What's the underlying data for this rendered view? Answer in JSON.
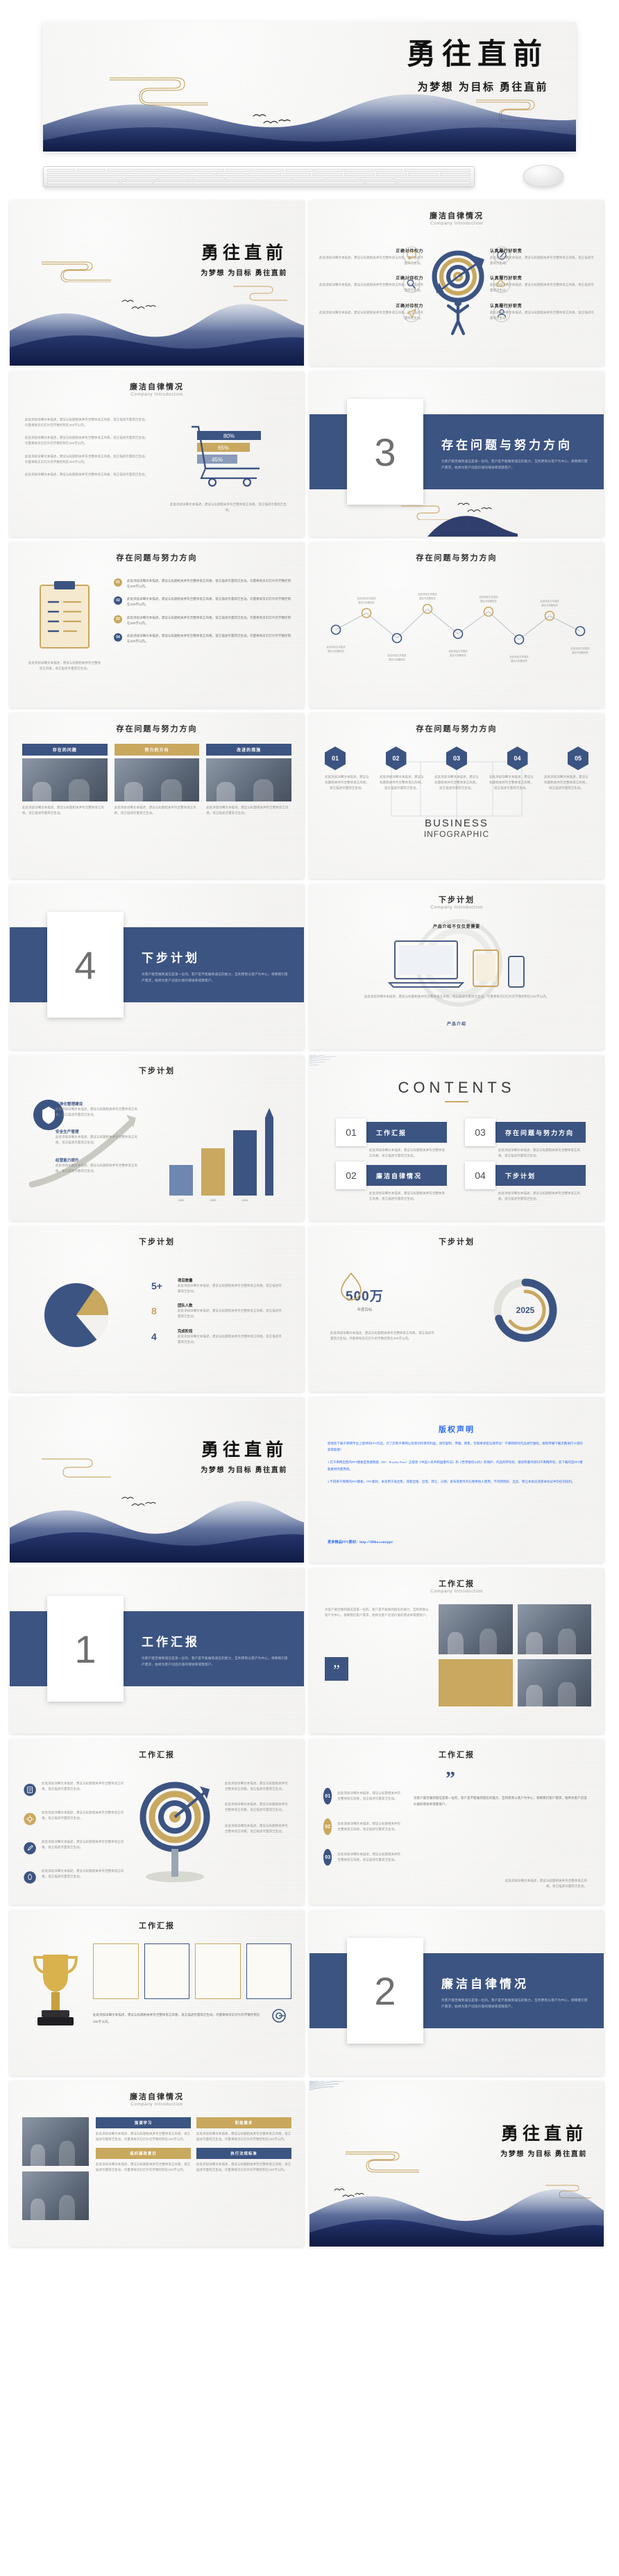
{
  "hero": {
    "title": "勇往直前",
    "subtitle": "为梦想 为目标 勇往直前"
  },
  "devices": {
    "keyboard_label": "keyboard-mockup",
    "mouse_label": "mouse-mockup"
  },
  "filler": {
    "short": "此处添加详细文本描述，建议与标题相关并符合整体语言风格，语言描述尽量简洁生动。",
    "medium": "此处添加详细文本描述，建议与标题相关并符合整体语言风格，语言描述尽量简洁生动。尽量将每页幻灯片的字数控制在200字以内。",
    "long": "为客户能否做到诚信是第一位的。客户是不能做到诚信的能力，互利原则以客户为中心，保障我们客户需求，始终为客户创造价值的增进率或我客户。"
  },
  "slides": [
    {
      "id": "cover-1",
      "type": "cover",
      "title": "勇往直前",
      "subtitle": "为梦想 为目标 勇往直前"
    },
    {
      "id": "intro-target",
      "type": "content-target",
      "title": "廉洁自律情况",
      "subtitle": "Company Introduction",
      "left_items": [
        {
          "heading": "正确对待权力",
          "icon": "message-icon"
        },
        {
          "heading": "正确对待权力",
          "icon": "search-icon"
        },
        {
          "heading": "正确对待权力",
          "icon": "paper-plane-icon"
        }
      ],
      "right_items": [
        {
          "heading": "认真履行好职责",
          "icon": "compass-icon"
        },
        {
          "heading": "认真履行好职责",
          "icon": "cloud-icon"
        },
        {
          "heading": "认真履行好职责",
          "icon": "user-icon"
        }
      ]
    },
    {
      "id": "discipline-cart",
      "type": "content-cart",
      "title": "廉洁自律情况",
      "subtitle": "Company Introduction",
      "bars": [
        {
          "label": "80%",
          "color": "#3c5482"
        },
        {
          "label": "65%",
          "color": "#c9a85f"
        },
        {
          "label": "45%",
          "color": "#8b9bb8"
        }
      ]
    },
    {
      "id": "divider-3",
      "type": "divider",
      "number": "3",
      "title": "存在问题与努力方向"
    },
    {
      "id": "problems-list",
      "type": "content-list",
      "title": "存在问题与努力方向",
      "bullets": [
        {
          "marker": "01"
        },
        {
          "marker": "02"
        },
        {
          "marker": "03"
        },
        {
          "marker": "04"
        }
      ],
      "note": "存在问题与努力方向"
    },
    {
      "id": "problems-timeline",
      "type": "content-timeline",
      "title": "存在问题与努力方向",
      "points": 9
    },
    {
      "id": "problems-photos",
      "type": "content-photos",
      "title": "存在问题与努力方向",
      "cards": [
        {
          "label": "存在的问题",
          "accent": "#3c5482"
        },
        {
          "label": "努力的方向",
          "accent": "#c9a85f"
        },
        {
          "label": "改进的措施",
          "accent": "#3c5482"
        }
      ]
    },
    {
      "id": "problems-hex",
      "type": "content-hex",
      "title": "存在问题与努力方向",
      "hexes": [
        "01",
        "02",
        "03",
        "04",
        "05"
      ],
      "center_line1": "BUSINESS",
      "center_line2": "INFOGRAPHIC"
    },
    {
      "id": "divider-4",
      "type": "divider",
      "number": "4",
      "title": "下步计划"
    },
    {
      "id": "plan-devices",
      "type": "content-devices",
      "title": "下步计划",
      "subtitle": "Company Introduction",
      "heading": "产品介绍不仅仅是需要",
      "footer": "产品介绍"
    },
    {
      "id": "plan-chart",
      "type": "content-chart",
      "title": "下步计划",
      "bars": [
        {
          "label": "标准化管理建设"
        },
        {
          "label": "安全生产管理"
        },
        {
          "label": "经营能力提升"
        }
      ]
    },
    {
      "id": "contents",
      "type": "contents",
      "title": "CONTENTS",
      "items": [
        {
          "num": "01",
          "label": "工作汇报"
        },
        {
          "num": "02",
          "label": "廉洁自律情况"
        },
        {
          "num": "03",
          "label": "存在问题与努力方向"
        },
        {
          "num": "04",
          "label": "下步计划"
        }
      ]
    },
    {
      "id": "plan-pie",
      "type": "content-pie",
      "title": "下步计划",
      "stats": [
        {
          "value": "5+",
          "label": "项目数量"
        },
        {
          "value": "8",
          "label": "团队人数"
        },
        {
          "value": "4",
          "label": "完成阶段"
        }
      ]
    },
    {
      "id": "plan-donut",
      "type": "content-donut",
      "title": "下步计划",
      "big_value": "500万",
      "big_label": "年度目标",
      "ring_label": "2025"
    },
    {
      "id": "cover-2",
      "type": "cover",
      "title": "勇往直前",
      "subtitle": "为梦想 为目标 勇往直前"
    },
    {
      "id": "copyright",
      "type": "copyright",
      "title": "版权声明",
      "paragraphs": [
        "感谢您下载千库网平台上提供的PPT作品，为了您和千库网以及原创作者的利益，请勿复制、传播、销售，否则将承担法律责任！千库网将对作品进行维权，按照传播下载次数进行十倍的索取赔偿！",
        "1.在千库网出售的PPT模板是免版税类（RF：Royalty-Free）正版受《中国人民共和国著作法》和《世界版权公约》的保护，作品的所有权、版权和著作权归千库网所有，您下载的是PPT模板素材的使用权。",
        "2.不得将千库网的PPT模板、PPT素材，本身用于再出售，或者出租、出借、转让、分销、发布或者作为礼物供他人使用，不得转授权、出卖、转让本协议或者本协议中的任何权利。"
      ],
      "footer": "更多精品PPT素材：http://588ku.com/ppt/"
    },
    {
      "id": "divider-1",
      "type": "divider",
      "number": "1",
      "title": "工作汇报"
    },
    {
      "id": "work-photos",
      "type": "content-photos2",
      "title": "工作汇报",
      "subtitle": "Company Introduction"
    },
    {
      "id": "work-icons",
      "type": "content-icons",
      "title": "工作汇报",
      "icons": [
        {
          "name": "document-icon",
          "color": "#3c5482"
        },
        {
          "name": "gear-icon",
          "color": "#c9a85f"
        },
        {
          "name": "edit-icon",
          "color": "#3c5482"
        },
        {
          "name": "rocket-icon",
          "color": "#3c5482"
        }
      ]
    },
    {
      "id": "work-quote",
      "type": "content-quote",
      "title": "工作汇报",
      "quote_mark": "”",
      "steps": [
        "01",
        "02",
        "03"
      ]
    },
    {
      "id": "work-awards",
      "type": "content-awards",
      "title": "工作汇报",
      "certificates": 4
    },
    {
      "id": "divider-2",
      "type": "divider",
      "number": "2",
      "title": "廉洁自律情况"
    },
    {
      "id": "discipline-photos",
      "type": "content-grid4",
      "title": "廉洁自律情况",
      "subtitle": "Company Introduction",
      "cards": [
        {
          "label": "强调学习",
          "accent": "#3c5482"
        },
        {
          "label": "职能需求",
          "accent": "#c9a85f"
        },
        {
          "label": "组织廉政意识",
          "accent": "#c9a85f"
        },
        {
          "label": "执行法规标准",
          "accent": "#3c5482"
        }
      ]
    },
    {
      "id": "cover-3",
      "type": "cover-final",
      "title": "勇往直前",
      "subtitle": "为梦想 为目标 勇往直前"
    }
  ],
  "colors": {
    "navy": "#3c5482",
    "deep_navy": "#1b2a5e",
    "gold": "#c9a85f",
    "paper": "#f2f1ee",
    "blue_link": "#2d6df6"
  }
}
